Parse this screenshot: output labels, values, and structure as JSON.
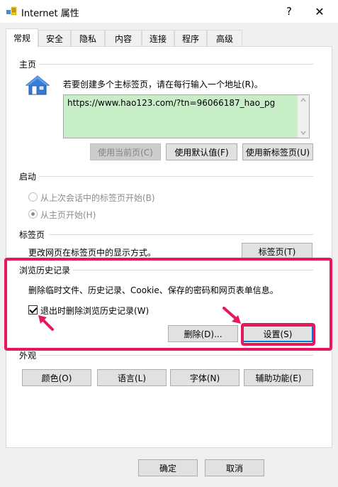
{
  "window": {
    "title": "Internet 属性",
    "help_glyph": "?",
    "close_glyph": "✕"
  },
  "tabs": [
    {
      "label": "常规",
      "active": true
    },
    {
      "label": "安全",
      "active": false
    },
    {
      "label": "隐私",
      "active": false
    },
    {
      "label": "内容",
      "active": false
    },
    {
      "label": "连接",
      "active": false
    },
    {
      "label": "程序",
      "active": false
    },
    {
      "label": "高级",
      "active": false
    }
  ],
  "homepage": {
    "title": "主页",
    "description": "若要创建多个主标签页，请在每行输入一个地址(R)。",
    "url": "https://www.hao123.com/?tn=96066187_hao_pg",
    "use_current_label": "使用当前页(C)",
    "use_default_label": "使用默认值(F)",
    "use_new_tab_label": "使用新标签页(U)"
  },
  "startup": {
    "title": "启动",
    "option_last_session": "从上次会话中的标签页开始(B)",
    "option_home_page": "从主页开始(H)"
  },
  "tabs_section": {
    "title": "标签页",
    "description": "更改网页在标签页中的显示方式。",
    "button_label": "标签页(T)"
  },
  "history": {
    "title": "浏览历史记录",
    "description": "删除临时文件、历史记录、Cookie、保存的密码和网页表单信息。",
    "checkbox_label": "退出时删除浏览历史记录(W)",
    "delete_label": "删除(D)...",
    "settings_label": "设置(S)"
  },
  "appearance": {
    "title": "外观",
    "colors_label": "颜色(O)",
    "languages_label": "语言(L)",
    "fonts_label": "字体(N)",
    "accessibility_label": "辅助功能(E)"
  },
  "footer": {
    "ok_label": "确定",
    "cancel_label": "取消"
  },
  "colors": {
    "highlight": "#e4175f",
    "url_background": "#c8eec8"
  }
}
